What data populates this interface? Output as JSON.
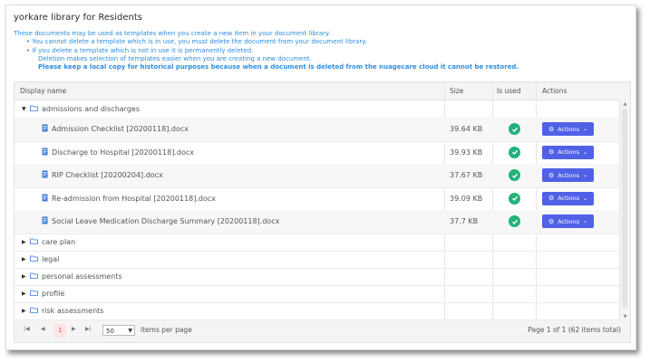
{
  "title": "yorkare library for Residents",
  "info": {
    "line1": "These documents may be used as templates when you create a new item in your document library.",
    "bullet1": "You cannot delete a template which is in use, you must delete the document from your document library.",
    "bullet2": "If you delete a template which is not in use it is permanently deleted.",
    "line4": "Deletion makes selection of templates easier when you are creating a new document.",
    "warning": "Please keep a local copy for historical purposes because when a document is deleted from the nuagecare cloud it cannot be restored."
  },
  "columns": {
    "name": "Display name",
    "size": "Size",
    "in_use": "Is used",
    "actions": "Actions"
  },
  "folders": [
    {
      "name": "admissions and discharges",
      "expanded": true
    },
    {
      "name": "care plan",
      "expanded": false
    },
    {
      "name": "legal",
      "expanded": false
    },
    {
      "name": "personal assessments",
      "expanded": false
    },
    {
      "name": "profile",
      "expanded": false
    },
    {
      "name": "risk assessments",
      "expanded": false
    }
  ],
  "documents": [
    {
      "name": "Admission Checklist [20200118].docx",
      "size": "39.64 KB",
      "used": true,
      "action": "Actions"
    },
    {
      "name": "Discharge to Hospital [20200118].docx",
      "size": "39.93 KB",
      "used": true,
      "action": "Actions"
    },
    {
      "name": "RIP Checklist [20200204].docx",
      "size": "37.67 KB",
      "used": true,
      "action": "Actions"
    },
    {
      "name": "Re-admission from Hospital [20200118].docx",
      "size": "39.09 KB",
      "used": true,
      "action": "Actions"
    },
    {
      "name": "Social Leave Medication Discharge Summary [20200118].docx",
      "size": "37.7 KB",
      "used": true,
      "action": "Actions"
    }
  ],
  "pager": {
    "current_page": "1",
    "page_size": "50",
    "page_size_label": "items per page",
    "summary": "Page 1 of 1 (62 items total)"
  },
  "colors": {
    "accent": "#5161e6",
    "check": "#23b27a",
    "info_text": "#2f8ee0",
    "active_page": "#e25a5a"
  }
}
